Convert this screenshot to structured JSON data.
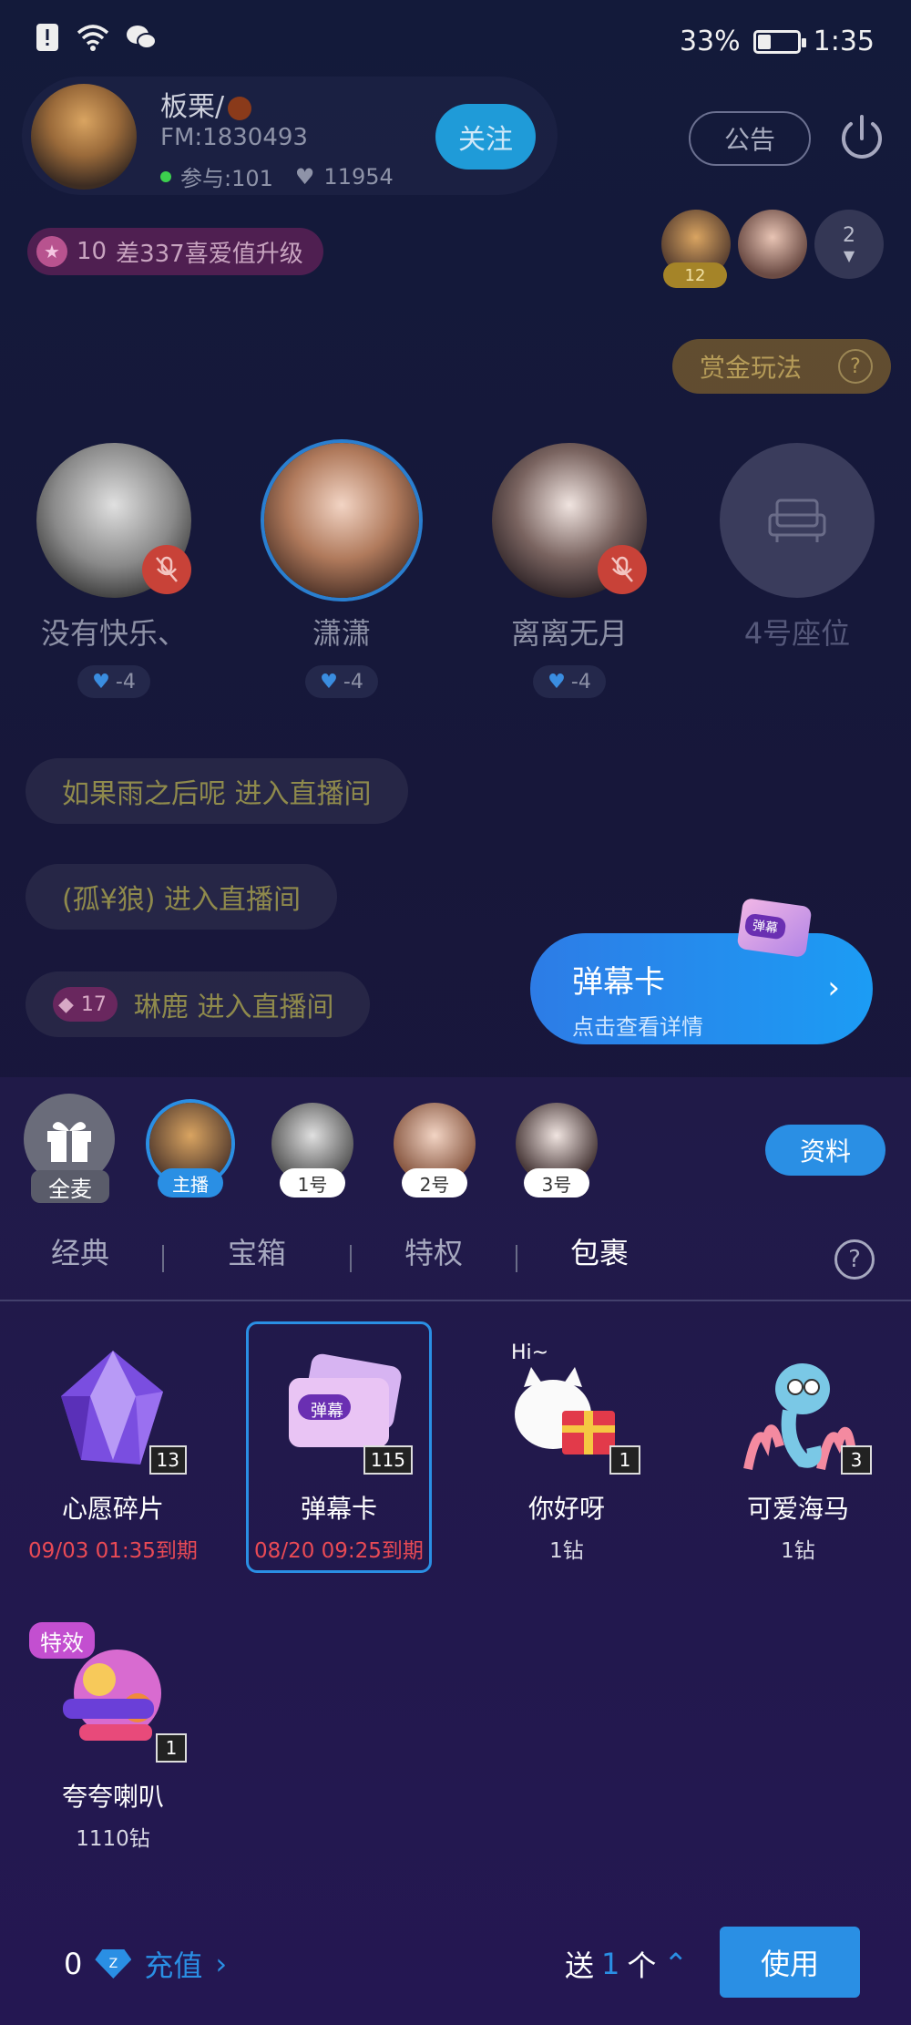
{
  "status_bar": {
    "battery": "33%",
    "time": "1:35",
    "battery_level": 0.33
  },
  "host": {
    "name": "板栗/",
    "fm": "FM:1830493",
    "participants": "参与:101",
    "likes": "11954",
    "follow_label": "关注"
  },
  "header": {
    "notice_label": "公告",
    "audience_count": "2"
  },
  "level": {
    "number": "10",
    "text": "差337喜爱值升级"
  },
  "mini_level": "12",
  "bounty": {
    "label": "赏金玩法",
    "help": "?"
  },
  "seats": [
    {
      "name": "没有快乐、",
      "hearts": "-4",
      "muted": true
    },
    {
      "name": "潇潇",
      "hearts": "-4",
      "muted": false
    },
    {
      "name": "离离无月",
      "hearts": "-4",
      "muted": true
    },
    {
      "name": "4号座位",
      "hearts": "",
      "muted": false
    }
  ],
  "chat": [
    {
      "text": "如果雨之后呢 进入直播间"
    },
    {
      "text": "(孤¥狼) 进入直播间"
    },
    {
      "badge": "17",
      "text": "琳鹿 进入直播间"
    }
  ],
  "danmaku_card": {
    "title": "弹幕卡",
    "subtitle": "点击查看详情",
    "chevron": "›",
    "deco_label": "弹幕"
  },
  "gift_panel": {
    "all_mic_label": "全麦",
    "targets": [
      {
        "tag": "主播",
        "selected": true
      },
      {
        "tag": "1号",
        "selected": false
      },
      {
        "tag": "2号",
        "selected": false
      },
      {
        "tag": "3号",
        "selected": false
      }
    ],
    "profile_label": "资料",
    "tabs": [
      "经典",
      "宝箱",
      "特权",
      "包裹"
    ],
    "active_tab": "包裹",
    "help": "?",
    "items": [
      {
        "name": "心愿碎片",
        "sub": "09/03 01:35到期",
        "count": "13",
        "expire": true
      },
      {
        "name": "弹幕卡",
        "sub": "08/20 09:25到期",
        "count": "115",
        "expire": true,
        "img_label": "弹幕"
      },
      {
        "name": "你好呀",
        "sub": "1钻",
        "count": "1",
        "expire": false,
        "img_label": "Hi~"
      },
      {
        "name": "可爱海马",
        "sub": "1钻",
        "count": "3",
        "expire": false
      },
      {
        "name": "夸夸喇叭",
        "sub": "1110钻",
        "count": "1",
        "expire": false,
        "fx_tag": "特效"
      }
    ]
  },
  "bottom_bar": {
    "balance": "0",
    "recharge_label": "充值",
    "send_label": "送",
    "send_count": "1",
    "send_unit": "个",
    "use_label": "使用"
  }
}
